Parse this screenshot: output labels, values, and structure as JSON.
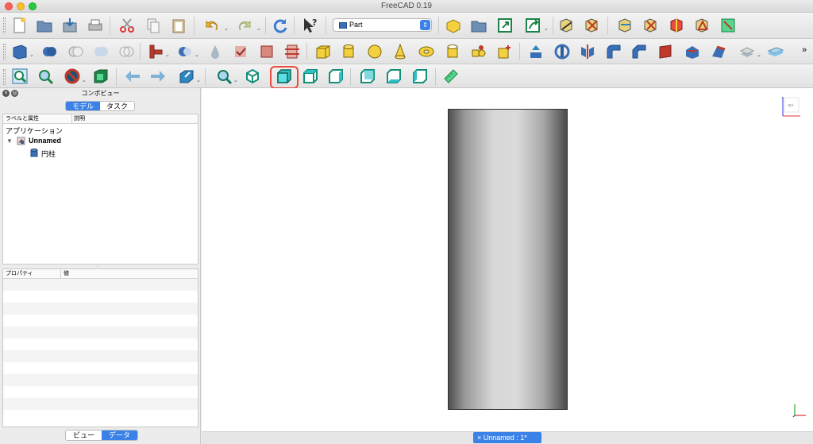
{
  "window": {
    "title": "FreeCAD 0.19"
  },
  "workbench": {
    "selected": "Part"
  },
  "combo_view": {
    "title": "コンボビュー",
    "tabs": [
      {
        "label": "モデル",
        "active": true
      },
      {
        "label": "タスク",
        "active": false
      }
    ],
    "tree_headers": {
      "label": "ラベルと属性",
      "desc": "説明"
    },
    "tree": {
      "root": "アプリケーション",
      "document": "Unnamed",
      "object": "円柱"
    },
    "property_headers": {
      "prop": "プロパティ",
      "value": "値"
    },
    "bottom_tabs": [
      {
        "label": "ビュー",
        "active": false
      },
      {
        "label": "データ",
        "active": true
      }
    ]
  },
  "view": {
    "tab_label": "Unnamed : 1*",
    "tab_close": "×"
  },
  "colors": {
    "accent": "#3b82e8",
    "highlight": "#e74b3c",
    "view_cyan": "#2fbfc6"
  }
}
